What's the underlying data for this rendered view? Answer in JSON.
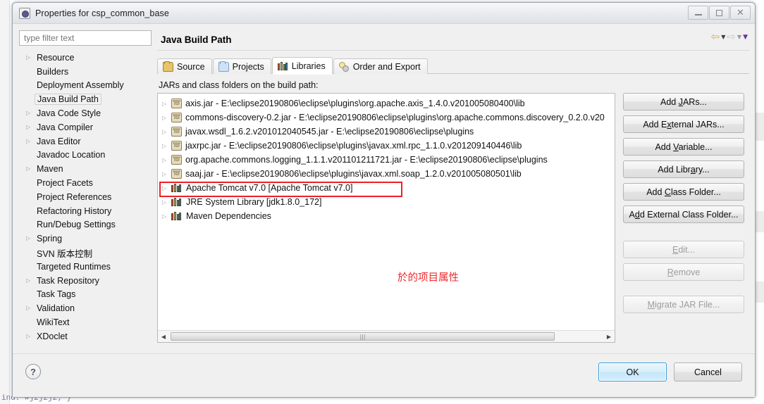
{
  "window": {
    "title": "Properties for csp_common_base",
    "icon": "properties-icon",
    "controls": {
      "minimize": "minimize-icon",
      "maximize": "maximize-icon",
      "close": "close-icon"
    }
  },
  "filter": {
    "placeholder": "type filter text",
    "value": ""
  },
  "sidebar": {
    "items": [
      {
        "label": "Resource",
        "expandable": true,
        "selected": false
      },
      {
        "label": "Builders",
        "expandable": false,
        "selected": false
      },
      {
        "label": "Deployment Assembly",
        "expandable": false,
        "selected": false
      },
      {
        "label": "Java Build Path",
        "expandable": false,
        "selected": true
      },
      {
        "label": "Java Code Style",
        "expandable": true,
        "selected": false
      },
      {
        "label": "Java Compiler",
        "expandable": true,
        "selected": false
      },
      {
        "label": "Java Editor",
        "expandable": true,
        "selected": false
      },
      {
        "label": "Javadoc Location",
        "expandable": false,
        "selected": false
      },
      {
        "label": "Maven",
        "expandable": true,
        "selected": false
      },
      {
        "label": "Project Facets",
        "expandable": false,
        "selected": false
      },
      {
        "label": "Project References",
        "expandable": false,
        "selected": false
      },
      {
        "label": "Refactoring History",
        "expandable": false,
        "selected": false
      },
      {
        "label": "Run/Debug Settings",
        "expandable": false,
        "selected": false
      },
      {
        "label": "Spring",
        "expandable": true,
        "selected": false
      },
      {
        "label": "SVN 版本控制",
        "expandable": false,
        "selected": false
      },
      {
        "label": "Targeted Runtimes",
        "expandable": false,
        "selected": false
      },
      {
        "label": "Task Repository",
        "expandable": true,
        "selected": false
      },
      {
        "label": "Task Tags",
        "expandable": false,
        "selected": false
      },
      {
        "label": "Validation",
        "expandable": true,
        "selected": false
      },
      {
        "label": "WikiText",
        "expandable": false,
        "selected": false
      },
      {
        "label": "XDoclet",
        "expandable": true,
        "selected": false
      }
    ]
  },
  "page": {
    "title": "Java Build Path",
    "nav": {
      "back_icon": "back-arrow-icon",
      "back_menu_icon": "chevron-down-icon",
      "forward_icon": "forward-arrow-icon",
      "forward_menu_icon": "chevron-down-icon",
      "view_menu_icon": "chevron-down-purple-icon"
    }
  },
  "tabs": [
    {
      "label": "Source",
      "icon": "source-folder-icon",
      "active": false
    },
    {
      "label": "Projects",
      "icon": "projects-folder-icon",
      "active": false
    },
    {
      "label": "Libraries",
      "icon": "libraries-books-icon",
      "active": true
    },
    {
      "label": "Order and Export",
      "icon": "order-export-icon",
      "active": false
    }
  ],
  "libraries": {
    "list_label": "JARs and class folders on the build path:",
    "entries": [
      {
        "text": "axis.jar - E:\\eclipse20190806\\eclipse\\plugins\\org.apache.axis_1.4.0.v201005080400\\lib",
        "icon": "jar-icon",
        "highlighted": false
      },
      {
        "text": "commons-discovery-0.2.jar - E:\\eclipse20190806\\eclipse\\plugins\\org.apache.commons.discovery_0.2.0.v20",
        "icon": "jar-icon",
        "highlighted": false
      },
      {
        "text": "javax.wsdl_1.6.2.v201012040545.jar - E:\\eclipse20190806\\eclipse\\plugins",
        "icon": "jar-icon",
        "highlighted": false
      },
      {
        "text": "jaxrpc.jar - E:\\eclipse20190806\\eclipse\\plugins\\javax.xml.rpc_1.1.0.v201209140446\\lib",
        "icon": "jar-icon",
        "highlighted": false
      },
      {
        "text": "org.apache.commons.logging_1.1.1.v201101211721.jar - E:\\eclipse20190806\\eclipse\\plugins",
        "icon": "jar-icon",
        "highlighted": false
      },
      {
        "text": "saaj.jar - E:\\eclipse20190806\\eclipse\\plugins\\javax.xml.soap_1.2.0.v201005080501\\lib",
        "icon": "jar-icon",
        "highlighted": false
      },
      {
        "text": "Apache Tomcat v7.0 [Apache Tomcat v7.0]",
        "icon": "library-icon",
        "highlighted": true
      },
      {
        "text": "JRE System Library [jdk1.8.0_172]",
        "icon": "library-icon",
        "highlighted": false
      },
      {
        "text": "Maven Dependencies",
        "icon": "library-icon",
        "highlighted": false
      }
    ],
    "annotation": "於的项目属性",
    "annotation_color": "#f0282d",
    "highlight_color": "#ec2127",
    "scroll_left_icon": "scroll-left-icon",
    "scroll_right_icon": "scroll-right-icon"
  },
  "side_buttons": [
    {
      "label": "Add JARs...",
      "mnemonic": "J",
      "enabled": true
    },
    {
      "label": "Add External JARs...",
      "mnemonic": "x",
      "enabled": true
    },
    {
      "label": "Add Variable...",
      "mnemonic": "V",
      "enabled": true
    },
    {
      "label": "Add Library...",
      "mnemonic": "a",
      "enabled": true
    },
    {
      "label": "Add Class Folder...",
      "mnemonic": "C",
      "enabled": true
    },
    {
      "label": "Add External Class Folder...",
      "mnemonic": "d",
      "enabled": true
    },
    {
      "label": "Edit...",
      "mnemonic": "E",
      "enabled": false
    },
    {
      "label": "Remove",
      "mnemonic": "R",
      "enabled": false
    },
    {
      "label": "Migrate JAR File...",
      "mnemonic": "M",
      "enabled": false
    }
  ],
  "footer": {
    "help_label": "?",
    "ok_label": "OK",
    "cancel_label": "Cancel"
  },
  "background": {
    "code_line": "ind: #j2j2j2; }"
  }
}
